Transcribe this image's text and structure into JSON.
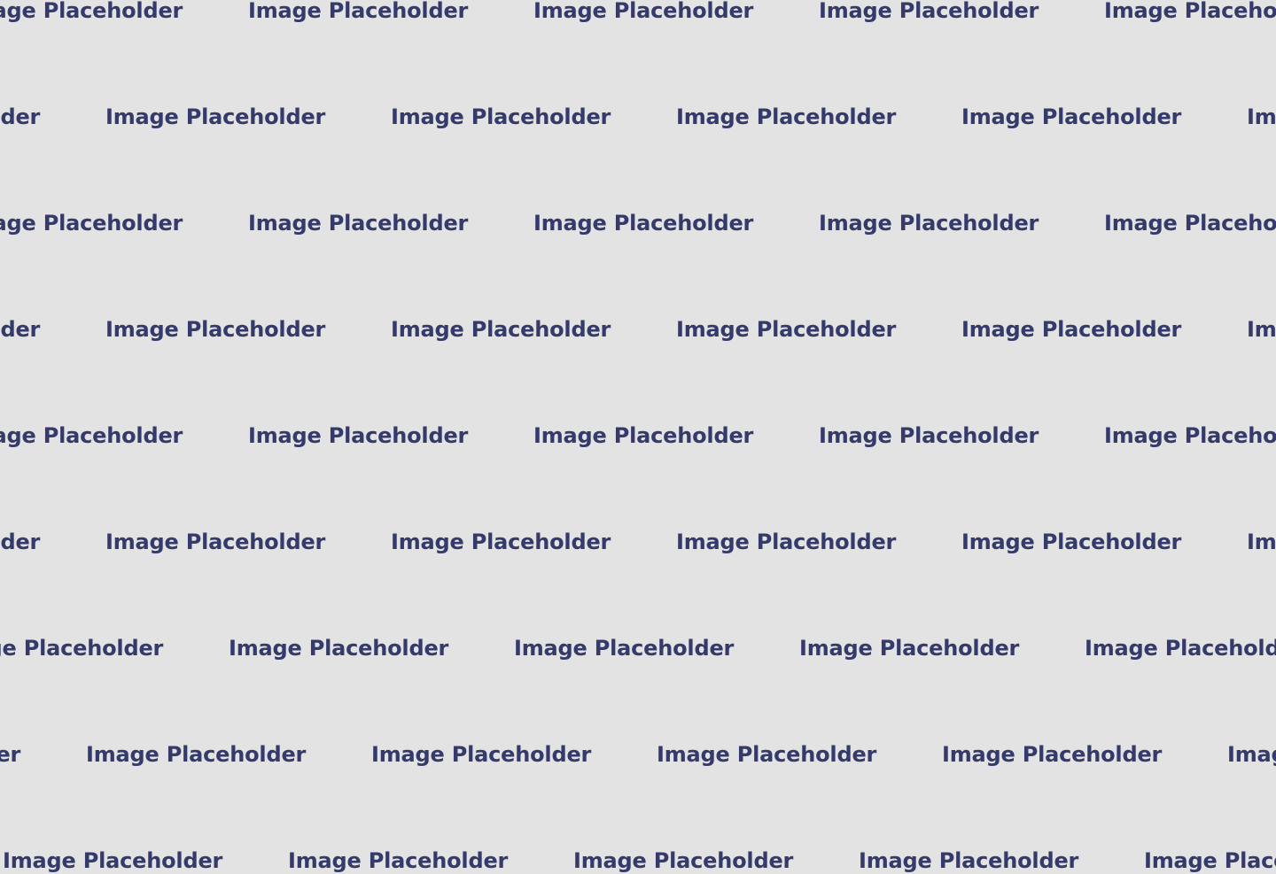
{
  "background_color": "#e3e3e3",
  "text_color": "#343a6b",
  "placeholder": {
    "label": "Image Placeholder"
  }
}
